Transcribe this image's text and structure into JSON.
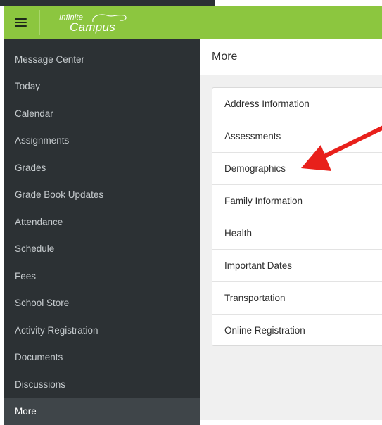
{
  "app": {
    "logo_top": "Infinite",
    "logo_bottom": "Campus",
    "brand_color": "#8cc63f",
    "menu_icon": "hamburger-menu-icon"
  },
  "sidebar": {
    "items": [
      {
        "label": "Message Center"
      },
      {
        "label": "Today"
      },
      {
        "label": "Calendar"
      },
      {
        "label": "Assignments"
      },
      {
        "label": "Grades"
      },
      {
        "label": "Grade Book Updates"
      },
      {
        "label": "Attendance"
      },
      {
        "label": "Schedule"
      },
      {
        "label": "Fees"
      },
      {
        "label": "School Store"
      },
      {
        "label": "Activity Registration"
      },
      {
        "label": "Documents"
      },
      {
        "label": "Discussions"
      },
      {
        "label": "More",
        "active": true
      }
    ]
  },
  "main": {
    "title": "More",
    "items": [
      {
        "label": "Address Information"
      },
      {
        "label": "Assessments"
      },
      {
        "label": "Demographics"
      },
      {
        "label": "Family Information"
      },
      {
        "label": "Health"
      },
      {
        "label": "Important Dates"
      },
      {
        "label": "Transportation"
      },
      {
        "label": "Online Registration"
      }
    ]
  },
  "annotation": {
    "arrow_color": "#e8201b"
  }
}
